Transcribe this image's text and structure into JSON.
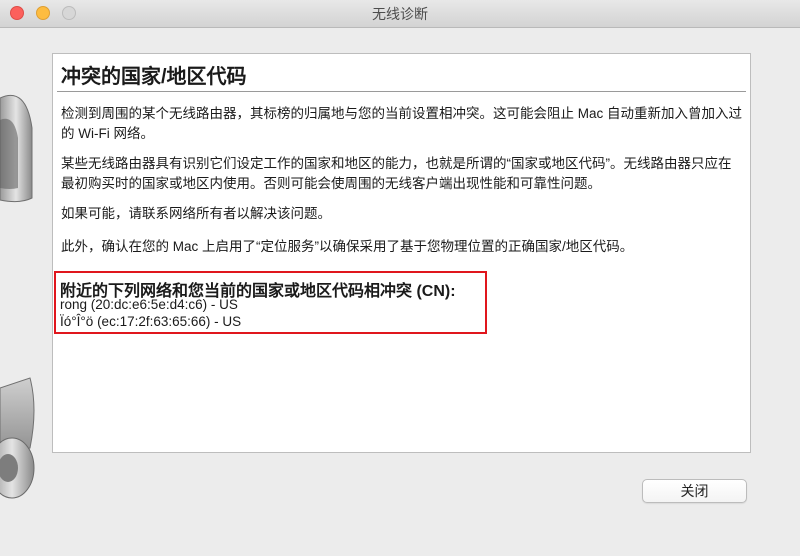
{
  "window": {
    "title": "无线诊断"
  },
  "panel": {
    "heading": "冲突的国家/地区代码",
    "paragraphs": [
      "检测到周围的某个无线路由器，其标榜的归属地与您的当前设置相冲突。这可能会阻止 Mac 自动重新加入曾加入过的 Wi-Fi 网络。",
      "某些无线路由器具有识别它们设定工作的国家和地区的能力，也就是所谓的“国家或地区代码”。无线路由器只应在最初购买时的国家或地区内使用。否则可能会使周围的无线客户端出现性能和可靠性问题。",
      "如果可能，请联系网络所有者以解决该问题。",
      "此外，确认在您的 Mac 上启用了“定位服务”以确保采用了基于您物理位置的正确国家/地区代码。"
    ],
    "conflict_title": "附近的下列网络和您当前的国家或地区代码相冲突 (CN):",
    "networks": [
      "rong (20:dc:e6:5e:d4:c6) - US",
      "Ïó°Î°ö (ec:17:2f:63:65:66) - US"
    ]
  },
  "buttons": {
    "close_label": "关闭"
  },
  "colors": {
    "highlight_border": "#e0161d",
    "close_light": "#fc605c",
    "minimize_light": "#fdbc40",
    "zoom_light": "#d7d7d7"
  }
}
